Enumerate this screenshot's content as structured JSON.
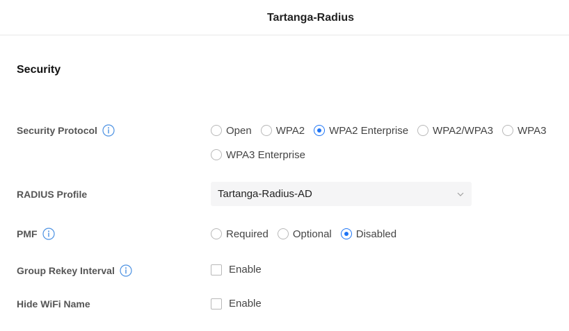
{
  "header": {
    "title": "Tartanga-Radius"
  },
  "section": {
    "title": "Security"
  },
  "security_protocol": {
    "label": "Security Protocol",
    "options": [
      {
        "label": "Open",
        "checked": false
      },
      {
        "label": "WPA2",
        "checked": false
      },
      {
        "label": "WPA2 Enterprise",
        "checked": true
      },
      {
        "label": "WPA2/WPA3",
        "checked": false
      },
      {
        "label": "WPA3",
        "checked": false
      },
      {
        "label": "WPA3 Enterprise",
        "checked": false
      }
    ]
  },
  "radius_profile": {
    "label": "RADIUS Profile",
    "value": "Tartanga-Radius-AD"
  },
  "pmf": {
    "label": "PMF",
    "options": [
      {
        "label": "Required",
        "checked": false
      },
      {
        "label": "Optional",
        "checked": false
      },
      {
        "label": "Disabled",
        "checked": true
      }
    ]
  },
  "group_rekey": {
    "label": "Group Rekey Interval",
    "checkbox_label": "Enable",
    "checked": false
  },
  "hide_wifi": {
    "label": "Hide WiFi Name",
    "checkbox_label": "Enable",
    "checked": false
  },
  "colors": {
    "accent": "#1d74f5",
    "info_icon": "#4a90e2",
    "label": "#555555"
  },
  "icons": {
    "info": "info-icon",
    "chevron": "chevron-down-icon"
  }
}
